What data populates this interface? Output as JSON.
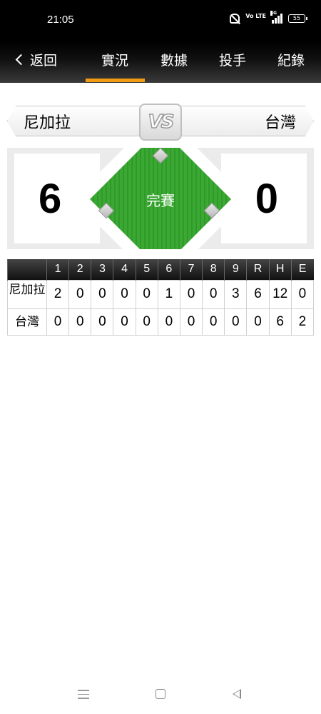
{
  "status_bar": {
    "time": "21:05",
    "volte_label": "Vo LTE",
    "signal_label": "4G",
    "battery": "55"
  },
  "nav": {
    "back_label": "返回",
    "tabs": [
      {
        "label": "實況",
        "active": true
      },
      {
        "label": "數據",
        "active": false
      },
      {
        "label": "投手",
        "active": false
      },
      {
        "label": "紀錄",
        "active": false
      }
    ],
    "accent_color": "#f39c12"
  },
  "matchup": {
    "away_team": "尼加拉",
    "home_team": "台灣",
    "vs_label": "VS",
    "away_score": "6",
    "home_score": "0",
    "game_status": "完賽",
    "field_color": "#3aa832"
  },
  "linescore": {
    "headers": [
      "",
      "1",
      "2",
      "3",
      "4",
      "5",
      "6",
      "7",
      "8",
      "9",
      "R",
      "H",
      "E"
    ],
    "rows": [
      {
        "team": "尼加拉",
        "values": [
          "2",
          "0",
          "0",
          "0",
          "0",
          "1",
          "0",
          "0",
          "3",
          "6",
          "12",
          "0"
        ]
      },
      {
        "team": "台灣",
        "values": [
          "0",
          "0",
          "0",
          "0",
          "0",
          "0",
          "0",
          "0",
          "0",
          "0",
          "6",
          "2"
        ]
      }
    ]
  },
  "system_nav": {
    "icons": [
      "menu-icon",
      "home-icon",
      "back-icon"
    ]
  }
}
